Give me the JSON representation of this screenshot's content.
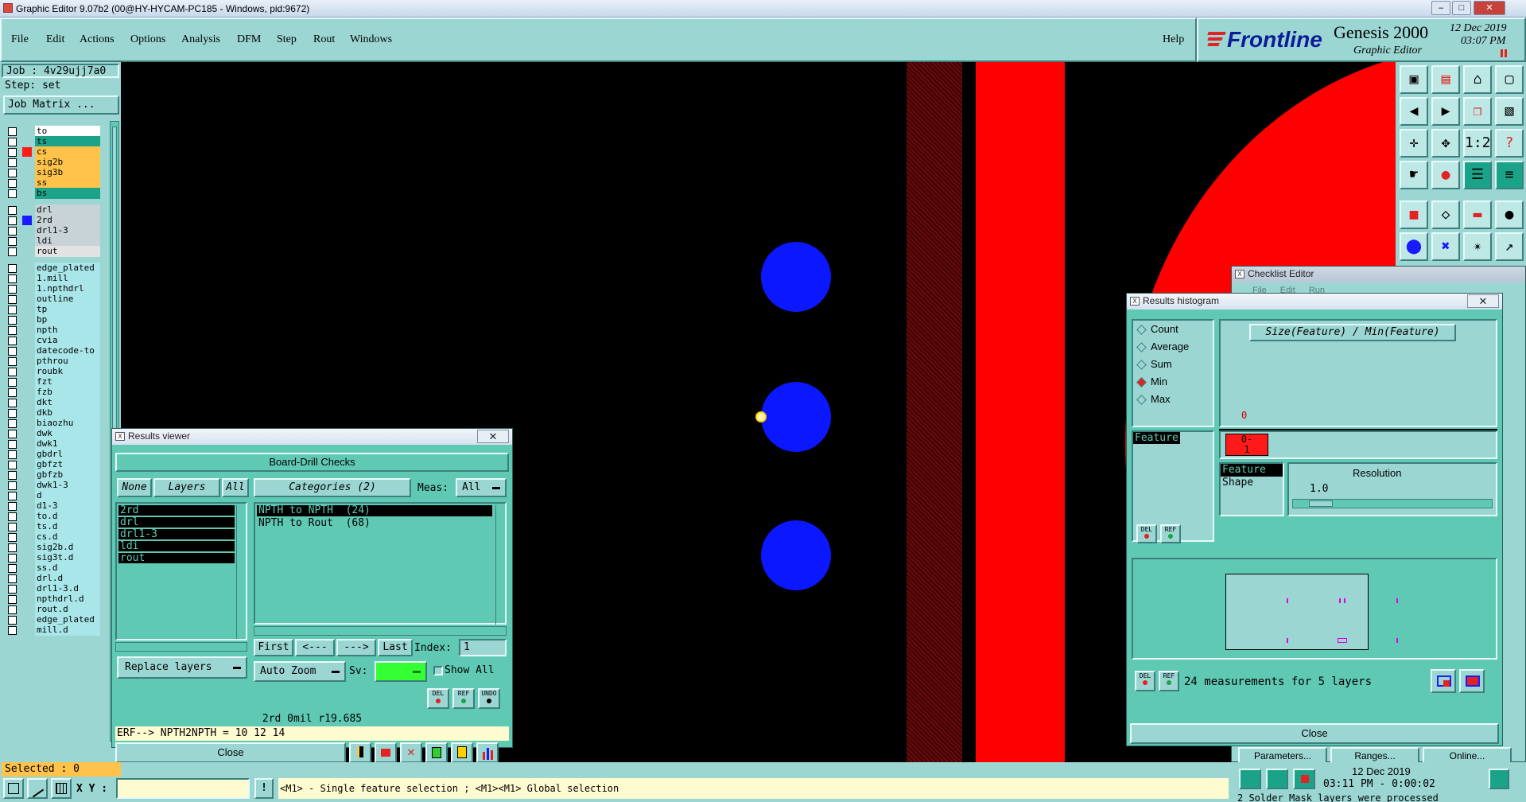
{
  "app": {
    "title": "Graphic Editor 9.07b2 (00@HY-HYCAM-PC185 - Windows, pid:9672)",
    "help": "Help",
    "brand": "Frontline",
    "product": "Genesis 2000",
    "subtitle": "Graphic Editor",
    "date": "12 Dec 2019",
    "time": "03:07 PM"
  },
  "menu": [
    "File",
    "Edit",
    "Actions",
    "Options",
    "Analysis",
    "DFM",
    "Step",
    "Rout",
    "Windows"
  ],
  "job": {
    "job_label": "Job : 4v29ujj7a0",
    "step_label": "Step: set",
    "matrix_btn": "Job Matrix ..."
  },
  "layers": [
    {
      "name": "to",
      "color": "#ffffff"
    },
    {
      "name": "ts",
      "color": "#1aa388"
    },
    {
      "name": "cs",
      "color": "#ffc24a",
      "mark": "#ff1a1a"
    },
    {
      "name": "sig2b",
      "color": "#ffc24a"
    },
    {
      "name": "sig3b",
      "color": "#ffc24a"
    },
    {
      "name": "ss",
      "color": "#ffc24a"
    },
    {
      "name": "bs",
      "color": "#1aa388"
    },
    {
      "name": "drl",
      "color": "#c7d3d6"
    },
    {
      "name": "2rd",
      "color": "#c7d3d6",
      "mark": "#1a1aff"
    },
    {
      "name": "drl1-3",
      "color": "#c7d3d6"
    },
    {
      "name": "ldi",
      "color": "#c7d3d6"
    },
    {
      "name": "rout",
      "color": "#e2e2e2"
    },
    {
      "name": "edge_plated",
      "color": "#a9e6ea"
    },
    {
      "name": "1.mill",
      "color": "#a9e6ea"
    },
    {
      "name": "1.npthdrl",
      "color": "#a9e6ea"
    },
    {
      "name": "outline",
      "color": "#a9e6ea"
    },
    {
      "name": "tp",
      "color": "#a9e6ea"
    },
    {
      "name": "bp",
      "color": "#a9e6ea"
    },
    {
      "name": "npth",
      "color": "#a9e6ea"
    },
    {
      "name": "cvia",
      "color": "#a9e6ea"
    },
    {
      "name": "datecode-to",
      "color": "#a9e6ea"
    },
    {
      "name": "pthrou",
      "color": "#a9e6ea"
    },
    {
      "name": "roubk",
      "color": "#a9e6ea"
    },
    {
      "name": "fzt",
      "color": "#a9e6ea"
    },
    {
      "name": "fzb",
      "color": "#a9e6ea"
    },
    {
      "name": "dkt",
      "color": "#a9e6ea"
    },
    {
      "name": "dkb",
      "color": "#a9e6ea"
    },
    {
      "name": "biaozhu",
      "color": "#a9e6ea"
    },
    {
      "name": "dwk",
      "color": "#a9e6ea"
    },
    {
      "name": "dwk1",
      "color": "#a9e6ea"
    },
    {
      "name": "gbdrl",
      "color": "#a9e6ea"
    },
    {
      "name": "gbfzt",
      "color": "#a9e6ea"
    },
    {
      "name": "gbfzb",
      "color": "#a9e6ea"
    },
    {
      "name": "dwk1-3",
      "color": "#a9e6ea"
    },
    {
      "name": "d",
      "color": "#a9e6ea"
    },
    {
      "name": "d1-3",
      "color": "#a9e6ea"
    },
    {
      "name": "to.d",
      "color": "#a9e6ea"
    },
    {
      "name": "ts.d",
      "color": "#a9e6ea"
    },
    {
      "name": "cs.d",
      "color": "#a9e6ea"
    },
    {
      "name": "sig2b.d",
      "color": "#a9e6ea"
    },
    {
      "name": "sig3t.d",
      "color": "#a9e6ea"
    },
    {
      "name": "ss.d",
      "color": "#a9e6ea"
    },
    {
      "name": "drl.d",
      "color": "#a9e6ea"
    },
    {
      "name": "drl1-3.d",
      "color": "#a9e6ea"
    },
    {
      "name": "npthdrl.d",
      "color": "#a9e6ea"
    },
    {
      "name": "rout.d",
      "color": "#a9e6ea"
    },
    {
      "name": "edge_plated",
      "color": "#a9e6ea"
    },
    {
      "name": "mill.d",
      "color": "#a9e6ea"
    }
  ],
  "selected": "Selected : 0",
  "status": {
    "xy_label": "X Y :",
    "xy_value": "",
    "hint": "<M1> - Single feature selection ; <M1><M1> Global selection",
    "date": "12 Dec 2019",
    "time": "03:11 PM - 0:00:02",
    "message": "2 Solder Mask layers were processed"
  },
  "results_viewer": {
    "title": "Results viewer",
    "header": "Board-Drill Checks",
    "none_btn": "None",
    "layers_btn": "Layers",
    "all_btn": "All",
    "categories": "Categories (2)",
    "meas_label": "Meas:",
    "meas_value": "All",
    "layer_list": [
      "2rd",
      "drl",
      "drl1-3",
      "ldi",
      "rout"
    ],
    "category_list": [
      "NPTH to NPTH  (24)",
      "NPTH to Rout  (68)"
    ],
    "nav": [
      "First",
      "<---",
      "--->",
      "Last"
    ],
    "index_label": "Index:",
    "index_value": "1",
    "auto_zoom": "Auto Zoom",
    "sv_label": "Sv:",
    "show_all": "Show All",
    "replace_layers": "Replace layers",
    "info_line": "2rd 0mil  r19.685",
    "erf_line": "ERF--> NPTH2NPTH = 10 12 14",
    "close": "Close",
    "del": "DEL",
    "ref": "REF",
    "undo": "UNDO"
  },
  "checklist": {
    "title": "Checklist Editor",
    "menu": [
      "File",
      "Edit",
      "Run"
    ],
    "buttons": [
      "Parameters...",
      "Ranges...",
      "Online..."
    ]
  },
  "histogram": {
    "title": "Results histogram",
    "options": [
      {
        "label": "Count",
        "checked": false
      },
      {
        "label": "Average",
        "checked": false
      },
      {
        "label": "Sum",
        "checked": false
      },
      {
        "label": "Min",
        "checked": true
      },
      {
        "label": "Max",
        "checked": false
      }
    ],
    "heading": "Size(Feature) / Min(Feature)",
    "axis_zero": "0",
    "bin_label": "0-",
    "bin_sub": "1",
    "feature_item": "Feature",
    "feature_list": [
      "Feature",
      "Shape"
    ],
    "resolution_label": "Resolution",
    "resolution_value": "1.0",
    "measurements": "24 measurements for 5 layers",
    "close": "Close",
    "del": "DEL",
    "ref": "REF"
  },
  "colors": {
    "panel": "#9bd6d3",
    "window": "#5fc9b4",
    "drill_blue": "#0b18ff",
    "rout_red": "#ff0000",
    "dark_red": "#6b0a0a",
    "sv_green": "#33ff33"
  }
}
